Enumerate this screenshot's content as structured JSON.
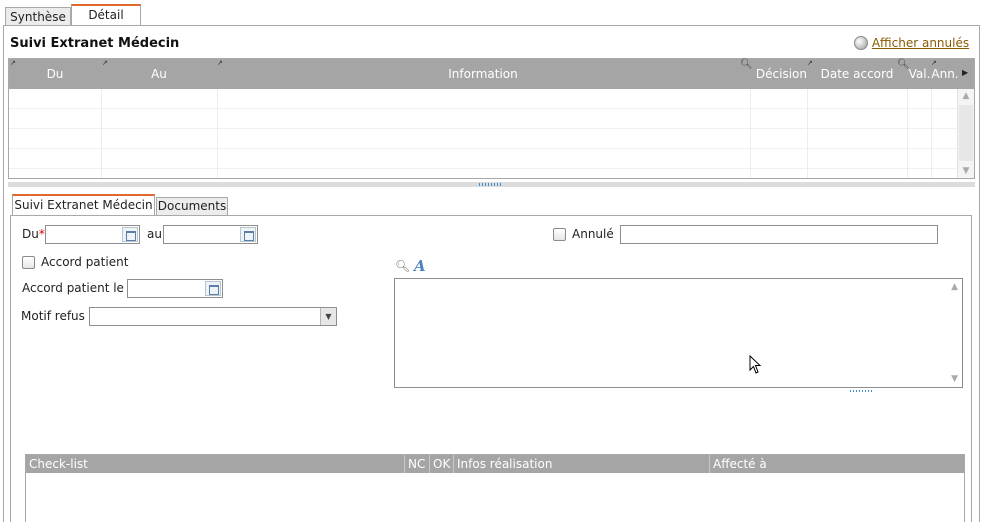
{
  "tabs": {
    "synthese": "Synthèse",
    "detail": "Détail"
  },
  "suivi": {
    "title": "Suivi Extranet Médecin",
    "show_cancelled": "Afficher annulés"
  },
  "grid": {
    "columns": [
      "Du",
      "Au",
      "Information",
      "Décision",
      "Date accord",
      "Val.",
      "Ann."
    ]
  },
  "subtabs": {
    "suivi": "Suivi Extranet Médecin",
    "documents": "Documents"
  },
  "form": {
    "du_label": "Du",
    "required_mark": "*",
    "au_label": "au",
    "annule_label": "Annulé",
    "accord_patient_label": "Accord patient",
    "accord_patient_le_label": "Accord patient le",
    "motif_refus_label": "Motif refus",
    "du_value": "",
    "au_value": "",
    "annule_value": "",
    "accord_patient_le_value": "",
    "motif_refus_value": "",
    "comment_value": ""
  },
  "checklist": {
    "columns": [
      "Check-list",
      "NC",
      "OK",
      "Infos réalisation",
      "Affecté à"
    ]
  }
}
